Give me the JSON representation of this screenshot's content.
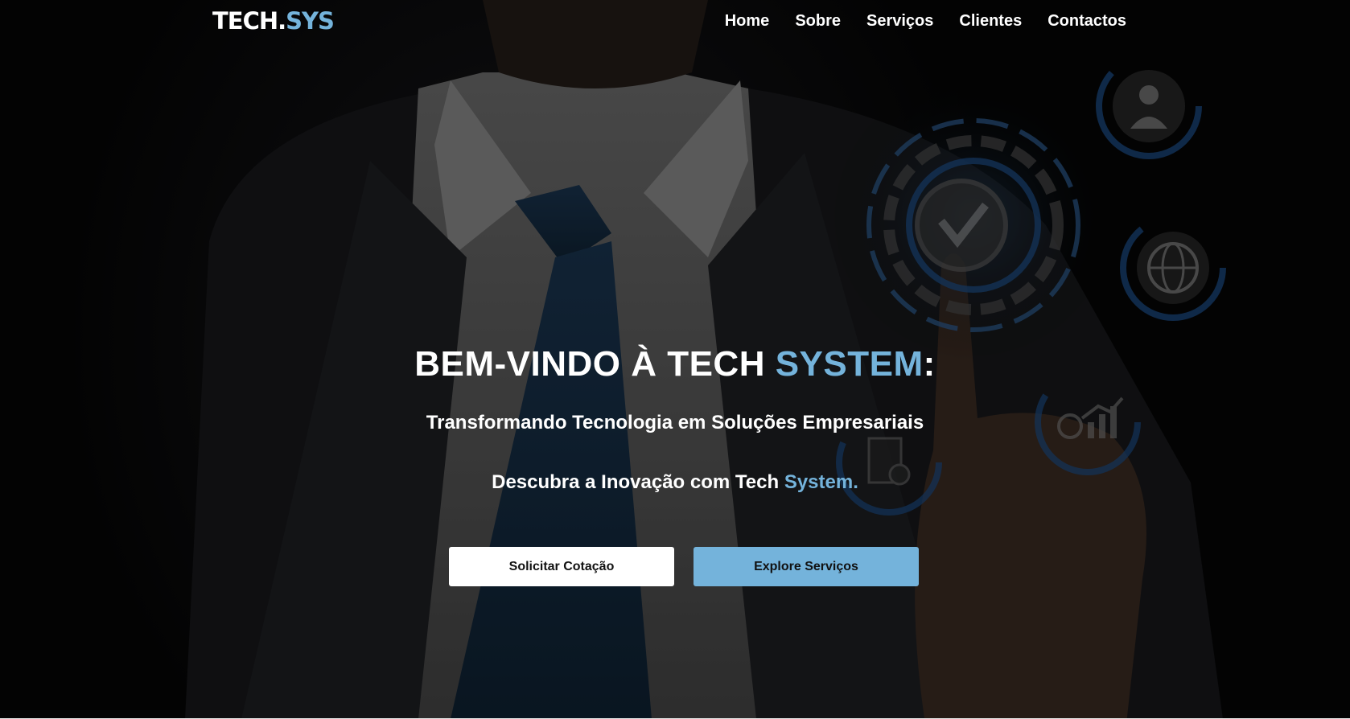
{
  "header": {
    "logo_main": "TECH.",
    "logo_accent": "SYS",
    "nav": [
      {
        "label": "Home"
      },
      {
        "label": "Sobre"
      },
      {
        "label": "Serviços"
      },
      {
        "label": "Clientes"
      },
      {
        "label": "Contactos"
      }
    ]
  },
  "hero": {
    "headline_prefix": "BEM-VINDO À TECH ",
    "headline_accent": "SYSTEM",
    "headline_suffix": ":",
    "subline": "Transformando Tecnologia em Soluções Empresariais",
    "subline2_prefix": "Descubra a Inovação com Tech ",
    "subline2_accent": "System.",
    "buttons": {
      "quote_label": "Solicitar Cotação",
      "services_label": "Explore Serviços"
    }
  },
  "colors": {
    "accent": "#74b3db",
    "text": "#ffffff",
    "background": "#000000"
  },
  "icons": [
    "users-icon",
    "checkmark-gear-icon",
    "globe-icon",
    "document-gear-icon",
    "analytics-chart-icon"
  ]
}
